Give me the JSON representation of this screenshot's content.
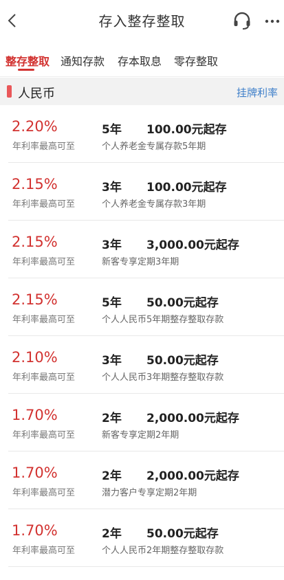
{
  "header": {
    "title": "存入整存整取"
  },
  "tabs": [
    {
      "label": "整存整取",
      "active": true
    },
    {
      "label": "通知存款",
      "active": false
    },
    {
      "label": "存本取息",
      "active": false
    },
    {
      "label": "零存整取",
      "active": false
    }
  ],
  "section": {
    "title": "人民币",
    "link": "挂牌利率"
  },
  "products": [
    {
      "rate": "2.20%",
      "rate_label": "年利率最高可至",
      "term": "5年",
      "amount": "100.00元起存",
      "name": "个人养老金专属存款5年期"
    },
    {
      "rate": "2.15%",
      "rate_label": "年利率最高可至",
      "term": "3年",
      "amount": "100.00元起存",
      "name": "个人养老金专属存款3年期"
    },
    {
      "rate": "2.15%",
      "rate_label": "年利率最高可至",
      "term": "3年",
      "amount": "3,000.00元起存",
      "name": "新客专享定期3年期"
    },
    {
      "rate": "2.15%",
      "rate_label": "年利率最高可至",
      "term": "5年",
      "amount": "50.00元起存",
      "name": "个人人民币5年期整存整取存款"
    },
    {
      "rate": "2.10%",
      "rate_label": "年利率最高可至",
      "term": "3年",
      "amount": "50.00元起存",
      "name": "个人人民币3年期整存整取存款"
    },
    {
      "rate": "1.70%",
      "rate_label": "年利率最高可至",
      "term": "2年",
      "amount": "2,000.00元起存",
      "name": "新客专享定期2年期"
    },
    {
      "rate": "1.70%",
      "rate_label": "年利率最高可至",
      "term": "2年",
      "amount": "2,000.00元起存",
      "name": "潜力客户专享定期2年期"
    },
    {
      "rate": "1.70%",
      "rate_label": "年利率最高可至",
      "term": "2年",
      "amount": "50.00元起存",
      "name": "个人人民币2年期整存整取存款"
    }
  ],
  "colors": {
    "accent": "#d23230",
    "link": "#3e7fc9",
    "section_bg": "#f2f2f2"
  },
  "icons": {
    "back": "chevron-left-icon",
    "service": "headset-icon",
    "more": "more-dots-icon"
  }
}
